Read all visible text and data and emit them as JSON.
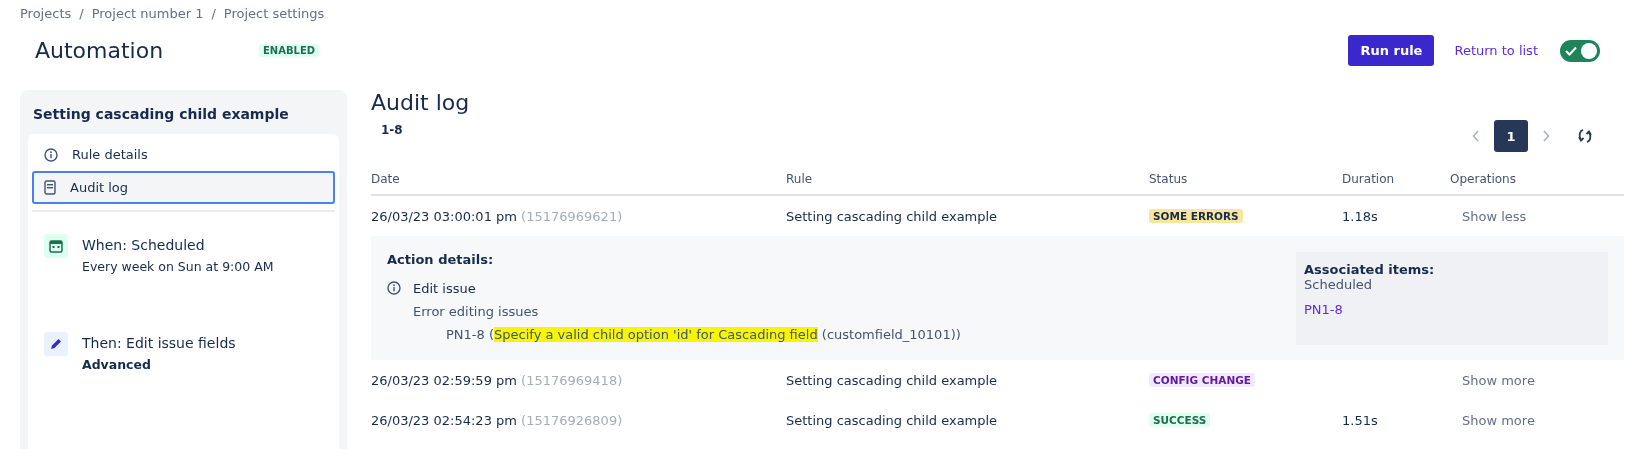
{
  "breadcrumbs": {
    "separator": "/",
    "items": [
      "Projects",
      "Project number 1",
      "Project settings"
    ]
  },
  "header": {
    "title": "Automation",
    "badge": "ENABLED",
    "run_button": "Run rule",
    "return_link": "Return to list",
    "toggle": {
      "on": true
    }
  },
  "sidebar": {
    "title": "Setting cascading child example",
    "nav": [
      {
        "label": "Rule details",
        "kind": "info",
        "selected": false
      },
      {
        "label": "Audit log",
        "kind": "log",
        "selected": true
      }
    ],
    "steps": [
      {
        "kind": "trigger",
        "title": "When: Scheduled",
        "detail": "Every week on Sun at 9:00 AM"
      },
      {
        "kind": "action",
        "title": "Then: Edit issue fields",
        "detail": "Advanced"
      }
    ]
  },
  "audit": {
    "title": "Audit log",
    "range": "1-8",
    "pagination": {
      "pages": [
        {
          "label": "1",
          "selected": true
        }
      ]
    },
    "columns": [
      "Date",
      "Rule",
      "Status",
      "Duration",
      "Operations"
    ],
    "rows": [
      {
        "date": "26/03/23 03:00:01 pm",
        "id": "(15176969621)",
        "rule": "Setting cascading child example",
        "status": "SOME ERRORS",
        "kind": "errors",
        "duration": "1.18s",
        "operation": "Show less",
        "details": {
          "title": "Action details:",
          "action": "Edit issue",
          "message": "Error editing issues",
          "error": {
            "issue": "PN1-8 (",
            "highlight": "Specify a valid child option 'id' for Cascading field",
            "rest": " (customfield_10101))"
          },
          "associated": {
            "title": "Associated items:",
            "source": "Scheduled",
            "link": "PN1-8"
          }
        }
      },
      {
        "date": "26/03/23 02:59:59 pm",
        "id": "(15176969418)",
        "rule": "Setting cascading child example",
        "status": "CONFIG CHANGE",
        "kind": "config",
        "operation": "Show more"
      },
      {
        "date": "26/03/23 02:54:23 pm",
        "id": "(15176926809)",
        "rule": "Setting cascading child example",
        "status": "SUCCESS",
        "kind": "success",
        "duration": "1.51s",
        "operation": "Show more"
      }
    ]
  }
}
